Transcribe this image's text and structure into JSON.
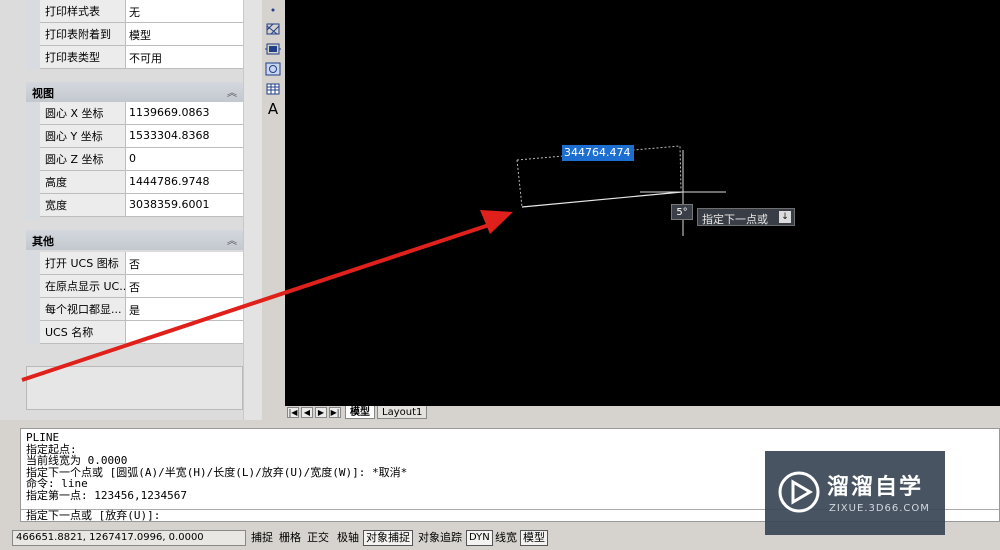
{
  "palette": {
    "top_rows": [
      {
        "name": "打印样式表",
        "value": "无"
      },
      {
        "name": "打印表附着到",
        "value": "模型"
      },
      {
        "name": "打印表类型",
        "value": "不可用"
      }
    ],
    "sections": [
      {
        "title": "视图",
        "rows": [
          {
            "name": "圆心 X 坐标",
            "value": "1139669.0863"
          },
          {
            "name": "圆心 Y 坐标",
            "value": "1533304.8368"
          },
          {
            "name": "圆心 Z 坐标",
            "value": "0"
          },
          {
            "name": "高度",
            "value": "1444786.9748"
          },
          {
            "name": "宽度",
            "value": "3038359.6001"
          }
        ]
      },
      {
        "title": "其他",
        "rows": [
          {
            "name": "打开 UCS 图标",
            "value": "否"
          },
          {
            "name": "在原点显示 UC...",
            "value": "否"
          },
          {
            "name": "每个视口都显...",
            "value": "是"
          },
          {
            "name": "UCS 名称",
            "value": ""
          }
        ]
      }
    ],
    "collapse_glyph": "︽"
  },
  "toolbar_icons": [
    "point-icon",
    "hatch-icon",
    "gradient-icon",
    "region-icon",
    "table-icon",
    "mtext-icon"
  ],
  "mtext_glyph": "A",
  "canvas": {
    "dimension_input": "344764.474",
    "angle_label": "5°",
    "prompt_tip": "指定下一点或",
    "dropdown_glyph": "↓"
  },
  "tabs": {
    "model": "模型",
    "layout1": "Layout1",
    "nav": [
      "|◀",
      "◀",
      "▶",
      "▶|"
    ]
  },
  "command": {
    "history": [
      "PLINE",
      "指定起点:",
      "当前线宽为 0.0000",
      "指定下一个点或 [圆弧(A)/半宽(H)/长度(L)/放弃(U)/宽度(W)]: *取消*",
      "命令: line",
      "指定第一点: 123456,1234567"
    ],
    "current": "指定下一点或 [放弃(U)]:"
  },
  "status": {
    "coords": "466651.8821,  1267417.0996, 0.0000",
    "buttons": [
      {
        "label": "捕捉",
        "on": false
      },
      {
        "label": "栅格",
        "on": false
      },
      {
        "label": "正交",
        "on": false
      },
      {
        "label": "极轴",
        "on": false
      },
      {
        "label": "对象捕捉",
        "on": true
      },
      {
        "label": "对象追踪",
        "on": false
      },
      {
        "label": "DYN",
        "on": true
      },
      {
        "label": "线宽",
        "on": false
      },
      {
        "label": "模型",
        "on": true
      }
    ]
  },
  "watermark": {
    "title": "溜溜自学",
    "url": "ZIXUE.3D66.COM"
  },
  "colors": {
    "annotation_arrow": "#e0201a",
    "canvas_bg": "#000000",
    "dimension_highlight": "#1c6fd1"
  }
}
